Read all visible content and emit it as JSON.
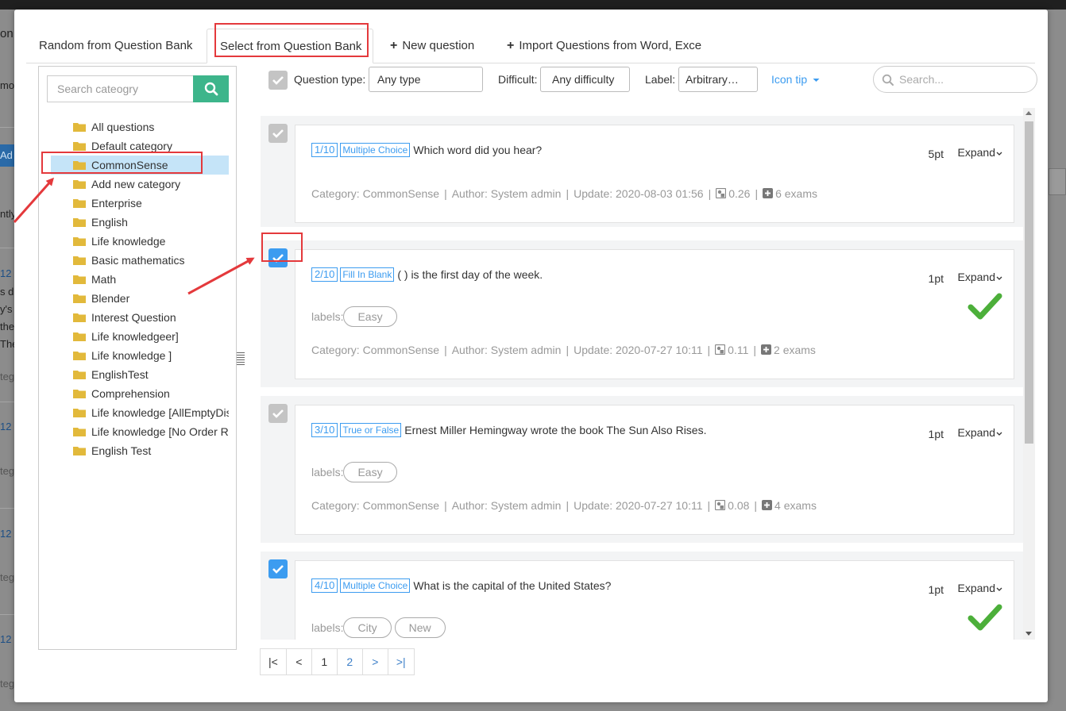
{
  "tabs": {
    "random": "Random from Question Bank",
    "select": "Select from Question Bank",
    "new_question": "New question",
    "import": "Import Questions from Word, Exce"
  },
  "left_panel": {
    "search_placeholder": "Search cateogry",
    "categories": [
      "All questions",
      "Default category",
      "CommonSense",
      "Add new category",
      "Enterprise",
      "English",
      "Life knowledge",
      "Basic mathematics",
      "Math",
      "Blender",
      "Interest Question",
      "Life knowledgeer]",
      "Life knowledge ]",
      "EnglishTest",
      "Comprehension",
      "Life knowledge [AllEmptyDis",
      "Life knowledge [No Order R",
      "English Test"
    ],
    "selected_index": 2
  },
  "filters": {
    "type_label": "Question type:",
    "type_value": "Any type",
    "difficulty_label": "Difficult:",
    "difficulty_value": "Any difficulty",
    "label_label": "Label:",
    "label_value": "Arbitrary…",
    "icon_tip": "Icon tip",
    "search_placeholder": "Search..."
  },
  "questions": [
    {
      "num": "1/10",
      "type": "Multiple Choice",
      "text": "Which word did you hear?",
      "points": "5pt",
      "expand": "Expand",
      "labels_prefix": "",
      "labels": [],
      "category": "Category: CommonSense",
      "author": "Author: System admin",
      "update": "Update: 2020-08-03 01:56",
      "score": "0.26",
      "exams": "6 exams",
      "checked": false
    },
    {
      "num": "2/10",
      "type": "Fill In Blank",
      "text": "( ) is the first day of the week.",
      "points": "1pt",
      "expand": "Expand",
      "labels_prefix": "labels:",
      "labels": [
        "Easy"
      ],
      "category": "Category: CommonSense",
      "author": "Author: System admin",
      "update": "Update: 2020-07-27 10:11",
      "score": "0.11",
      "exams": "2 exams",
      "checked": true
    },
    {
      "num": "3/10",
      "type": "True or False",
      "text": "Ernest Miller Hemingway wrote the book The Sun Also Rises.",
      "points": "1pt",
      "expand": "Expand",
      "labels_prefix": "labels:",
      "labels": [
        "Easy"
      ],
      "category": "Category: CommonSense",
      "author": "Author: System admin",
      "update": "Update: 2020-07-27 10:11",
      "score": "0.08",
      "exams": "4 exams",
      "checked": false
    },
    {
      "num": "4/10",
      "type": "Multiple Choice",
      "text": "What is the capital of the United States?",
      "points": "1pt",
      "expand": "Expand",
      "labels_prefix": "labels:",
      "labels": [
        "City",
        "New"
      ],
      "checked": true
    }
  ],
  "pagination": {
    "first": "|<",
    "prev": "<",
    "pages": [
      "1",
      "2"
    ],
    "current": "1",
    "next": ">",
    "last": ">|"
  },
  "background": {
    "frag_on": "on",
    "frag_mo": "mo",
    "frag_ad": "Ad",
    "frag_ntly": "ntly",
    "frag_12a": "12",
    "frag_s": "s d",
    "frag_ys": "y's",
    "frag_the": "the",
    "frag_the2": "The",
    "frag_teg1": "teg",
    "frag_12b": "12",
    "frag_teg2": "teg",
    "frag_12c": "12",
    "frag_teg3": "teg",
    "frag_12d": "12",
    "frag_teg4": "teg"
  },
  "colors": {
    "accent": "#3c9cf0",
    "search_green": "#3db58b",
    "highlight_red": "#e4393c",
    "check_green": "#4caf3a",
    "selected_bg": "#c5e4f8"
  }
}
